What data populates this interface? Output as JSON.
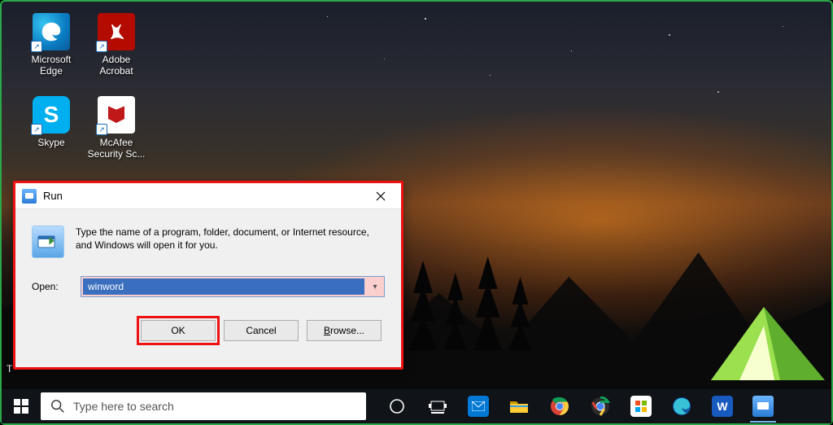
{
  "desktop_icons": [
    {
      "name": "edge",
      "label": "Microsoft Edge"
    },
    {
      "name": "acrobat",
      "label": "Adobe Acrobat"
    },
    {
      "name": "skype",
      "label": "Skype"
    },
    {
      "name": "mcafee",
      "label": "McAfee Security Sc..."
    }
  ],
  "run_dialog": {
    "title": "Run",
    "description": "Type the name of a program, folder, document, or Internet resource, and Windows will open it for you.",
    "open_label": "Open:",
    "input_value": "winword",
    "buttons": {
      "ok": "OK",
      "cancel": "Cancel",
      "browse": "Browse..."
    }
  },
  "taskbar": {
    "search_placeholder": "Type here to search"
  },
  "peek_label": "T"
}
